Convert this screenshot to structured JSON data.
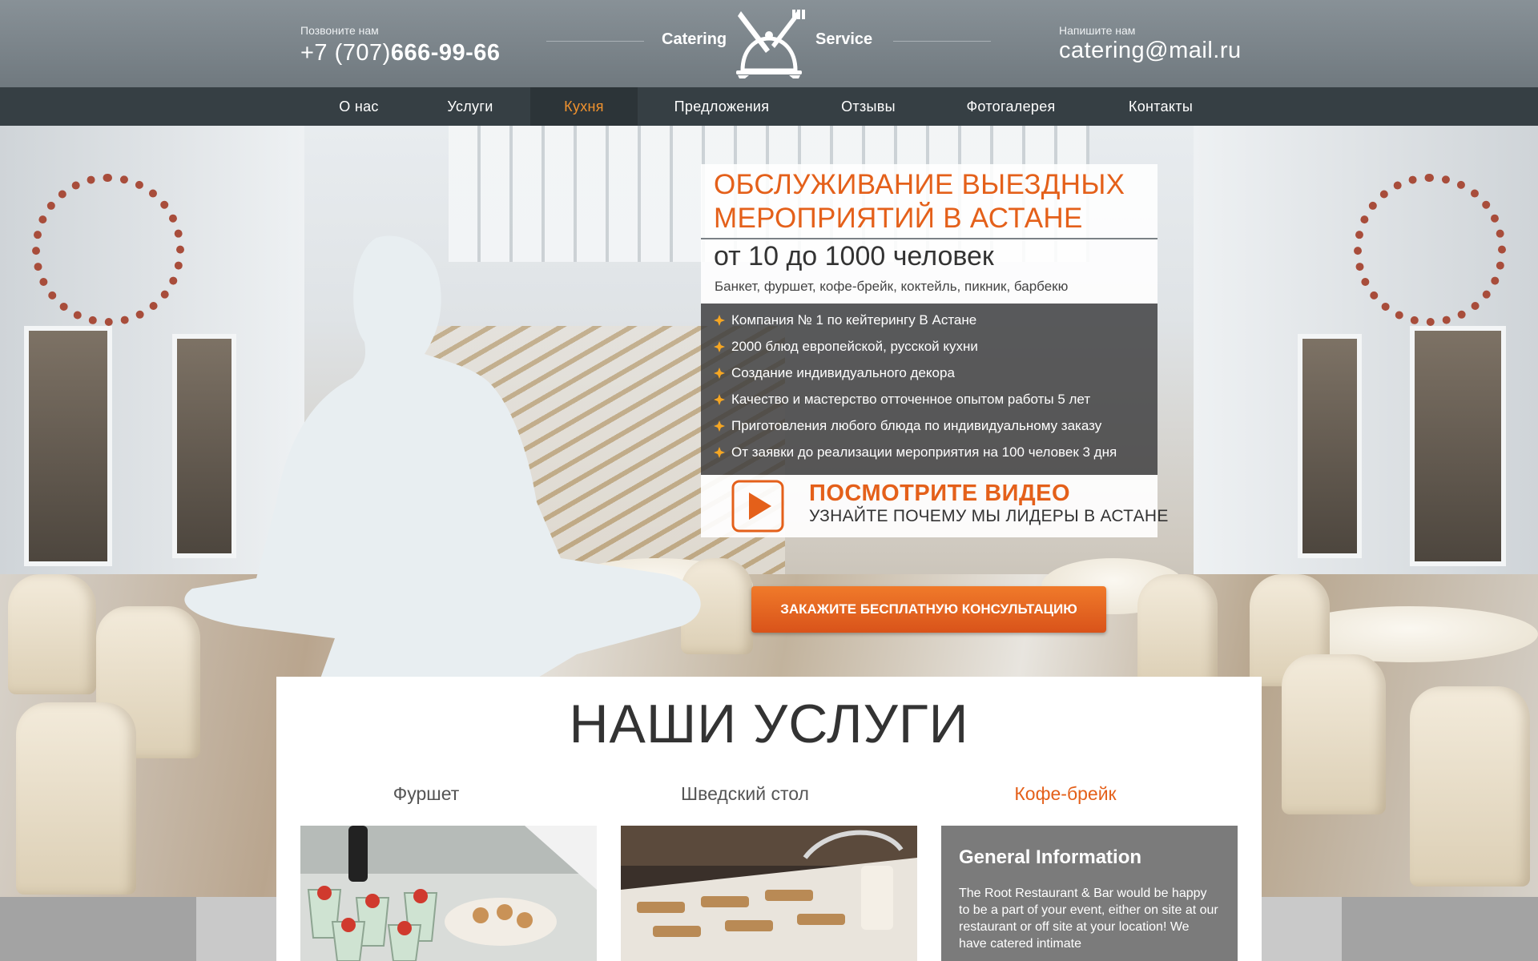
{
  "header": {
    "call_label": "Позвоните нам",
    "phone_prefix": "+7 (707)",
    "phone_number": "666-99-66",
    "logo_left": "Catering",
    "logo_right": "Service",
    "write_label": "Напишите нам",
    "email": "catering@mail.ru"
  },
  "nav": {
    "items": [
      {
        "label": "О нас"
      },
      {
        "label": "Услуги"
      },
      {
        "label": "Кухня"
      },
      {
        "label": "Предложения"
      },
      {
        "label": "Отзывы"
      },
      {
        "label": "Фотогалерея"
      },
      {
        "label": "Контакты"
      }
    ],
    "active": "Кухня"
  },
  "hero": {
    "title_line1": "ОБСЛУЖИВАНИЕ ВЫЕЗДНЫХ",
    "title_line2": "МЕРОПРИЯТИЙ В АСТАНЕ",
    "subtitle": "от 10 до 1000 человек",
    "events": "Банкет, фуршет, кофе-брейк, коктейль, пикник, барбекю",
    "features": [
      "Компания № 1 по кейтерингу В Астане",
      "2000 блюд европейской, русской кухни",
      "Создание индивидуального декора",
      "Качество и мастерство отточенное опытом работы 5 лет",
      "Приготовления любого блюда по индивидуальному заказу",
      "От заявки до реализации мероприятия на 100 человек 3 дня"
    ],
    "video_title": "ПОСМОТРИТЕ ВИДЕО",
    "video_subtitle": "УЗНАЙТЕ ПОЧЕМУ МЫ ЛИДЕРЫ В АСТАНЕ",
    "cta": "ЗАКАЖИТЕ БЕСПЛАТНУЮ КОНСУЛЬТАЦИЮ"
  },
  "services": {
    "title": "НАШИ УСЛУГИ",
    "tabs": [
      {
        "label": "Фуршет"
      },
      {
        "label": "Шведский стол"
      },
      {
        "label": "Кофе-брейк"
      }
    ],
    "active": "Кофе-брейк",
    "info_title": "General Information",
    "info_text": "The Root Restaurant & Bar would be happy to be a part of your event, either on site at our restaurant or off site at your location!  We have catered intimate"
  },
  "colors": {
    "accent": "#e4601a",
    "nav_bg": "#363f44",
    "header_bg": "#7d868c",
    "nav_active": "#f0922e"
  },
  "icons": [
    "cloche-fork-knife-icon",
    "star-bullet-icon",
    "play-icon"
  ]
}
